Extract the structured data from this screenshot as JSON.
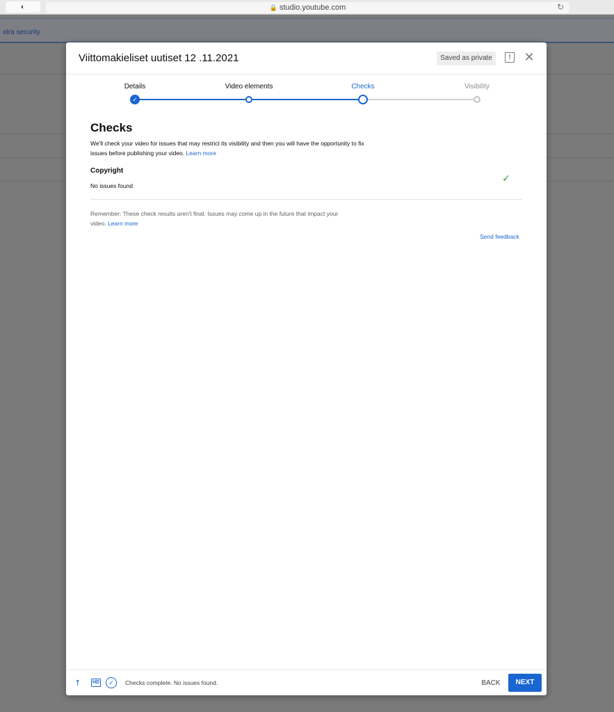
{
  "browser": {
    "url": "studio.youtube.com",
    "shield_icon": "shield-icon",
    "reload_icon": "reload-icon"
  },
  "background": {
    "strip_text": "xtra security"
  },
  "dialog": {
    "title": "Viittomakieliset uutiset 12 .11.2021",
    "saved_chip": "Saved as private",
    "feedback_icon": "report-icon",
    "close_icon": "close-icon"
  },
  "stepper": {
    "steps": [
      {
        "label": "Details",
        "state": "done"
      },
      {
        "label": "Video elements",
        "state": "done"
      },
      {
        "label": "Checks",
        "state": "active"
      },
      {
        "label": "Visibility",
        "state": "inactive"
      }
    ]
  },
  "checks": {
    "title": "Checks",
    "intro": "We'll check your video for issues that may restrict its visibility and then you will have the opportunity to fix issues before publishing your video.",
    "intro_link": "Learn more",
    "copyright_title": "Copyright",
    "copyright_status": "No issues found",
    "note": "Remember: These check results aren't final. Issues may come up in the future that impact your video.",
    "note_link": "Learn more",
    "send_feedback": "Send feedback"
  },
  "footer": {
    "status": "Checks complete. No issues found.",
    "back_label": "BACK",
    "next_label": "NEXT"
  },
  "colors": {
    "accent": "#1a66d1",
    "success": "#2f9c48"
  }
}
